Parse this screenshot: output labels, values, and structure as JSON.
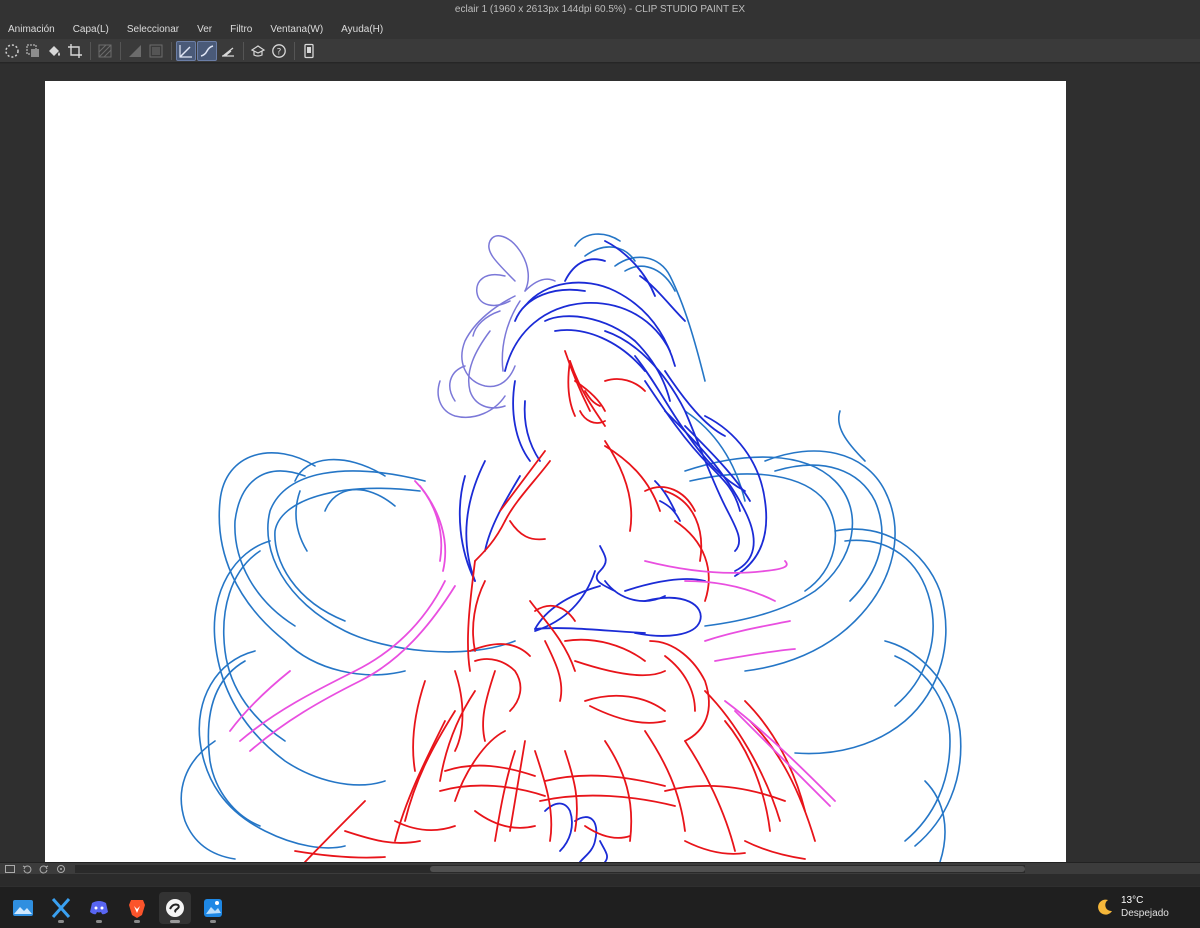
{
  "window": {
    "title": "eclair 1 (1960 x 2613px 144dpi 60.5%)  - CLIP STUDIO PAINT EX"
  },
  "menu": {
    "items": [
      "Animación",
      "Capa(L)",
      "Seleccionar",
      "Ver",
      "Filtro",
      "Ventana(W)",
      "Ayuda(H)"
    ]
  },
  "toolbar": {
    "buttons": [
      {
        "icon": "transform-dotted-icon",
        "active": false
      },
      {
        "icon": "select-invert-icon",
        "active": false
      },
      {
        "icon": "fill-bucket-icon",
        "active": false
      },
      {
        "icon": "crop-icon",
        "active": false
      },
      {
        "icon": "hatch-off-icon",
        "active": false
      },
      {
        "icon": "layer-ref-icon",
        "active": false
      },
      {
        "icon": "layer-mask-icon",
        "active": false
      },
      {
        "icon": "ruler-snap-icon",
        "active": true
      },
      {
        "icon": "curve-snap-icon",
        "active": true
      },
      {
        "icon": "perspective-ruler-icon",
        "active": false
      },
      {
        "icon": "3d-model-icon",
        "active": false
      },
      {
        "icon": "help-icon",
        "active": false
      },
      {
        "icon": "device-icon",
        "active": false
      }
    ]
  },
  "canvas": {
    "paper_color": "#ffffff",
    "stroke_colors": {
      "hair_dark_blue": "#1b2bd6",
      "hair_light_blue": "#1a6fc4",
      "bow_lavender": "#7b78d8",
      "body_red": "#e8141a",
      "sash_pink": "#e94fe0"
    }
  },
  "taskbar": {
    "apps": [
      {
        "icon": "photos-app-icon",
        "running": false
      },
      {
        "icon": "xcode-x-app-icon",
        "running": true
      },
      {
        "icon": "discord-app-icon",
        "running": true
      },
      {
        "icon": "brave-browser-icon",
        "running": true
      },
      {
        "icon": "clip-studio-paint-icon",
        "running": true,
        "active": true
      },
      {
        "icon": "gallery-app-icon",
        "running": true
      }
    ],
    "weather": {
      "icon": "moon-icon",
      "temperature": "13°C",
      "condition": "Despejado"
    }
  }
}
